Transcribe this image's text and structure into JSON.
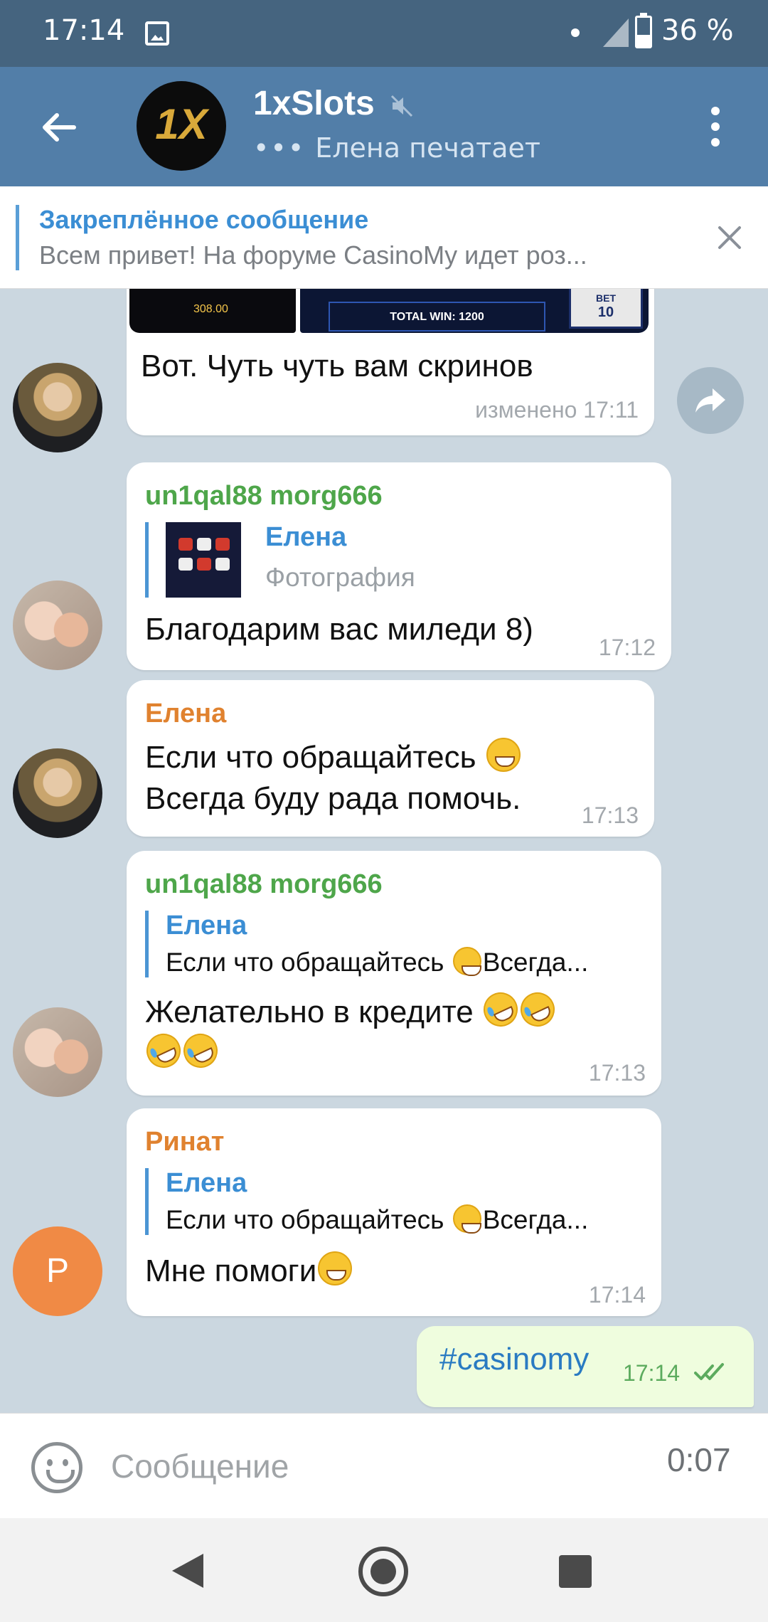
{
  "status_bar": {
    "time": "17:14",
    "battery": "36 %"
  },
  "header": {
    "title": "1xSlots",
    "avatar_text": "1X",
    "typing_name_status": "Елена печатает"
  },
  "pinned": {
    "title": "Закреплённое сообщение",
    "text": "Всем привет! На форуме CasinoMy идет роз..."
  },
  "messages": [
    {
      "text": "Вот. Чуть чуть вам скринов",
      "time": "изменено 17:11",
      "screenshot_win": "308.00",
      "screenshot_total": "TOTAL WIN: 1200",
      "screenshot_bet_label": "BET",
      "screenshot_bet": "10"
    },
    {
      "sender": "un1qal88 morg666",
      "reply_name": "Елена",
      "reply_text": "Фотография",
      "text": "Благодарим вас миледи 8)",
      "time": "17:12"
    },
    {
      "sender": "Елена",
      "text_line1": "Если что обращайтесь",
      "text_line2": "Всегда буду рада помочь.",
      "time": "17:13"
    },
    {
      "sender": "un1qal88 morg666",
      "reply_name": "Елена",
      "reply_text_a": "Если что обращайтесь",
      "reply_text_b": "Всегда...",
      "text": "Желательно в кредите",
      "time": "17:13"
    },
    {
      "sender": "Ринат",
      "avatar_letter": "Р",
      "reply_name": "Елена",
      "reply_text_a": "Если что обращайтесь",
      "reply_text_b": "Всегда...",
      "text": "Мне помоги",
      "time": "17:14"
    }
  ],
  "outgoing": {
    "text": "#casinomy",
    "time": "17:14"
  },
  "composer": {
    "placeholder": "Сообщение",
    "record_time": "0:07"
  },
  "colors": {
    "header": "#527ea8",
    "status_bar": "#45647f",
    "accent_blue": "#3b8ed4",
    "sender_green": "#4ea64a",
    "sender_orange": "#e0822f",
    "outgoing_bg": "#effdde"
  },
  "icons": [
    "back-arrow-icon",
    "mute-icon",
    "more-vert-icon",
    "close-icon",
    "forward-icon",
    "emoji-icon",
    "double-check-icon",
    "nav-back-icon",
    "nav-home-icon",
    "nav-recent-icon"
  ]
}
